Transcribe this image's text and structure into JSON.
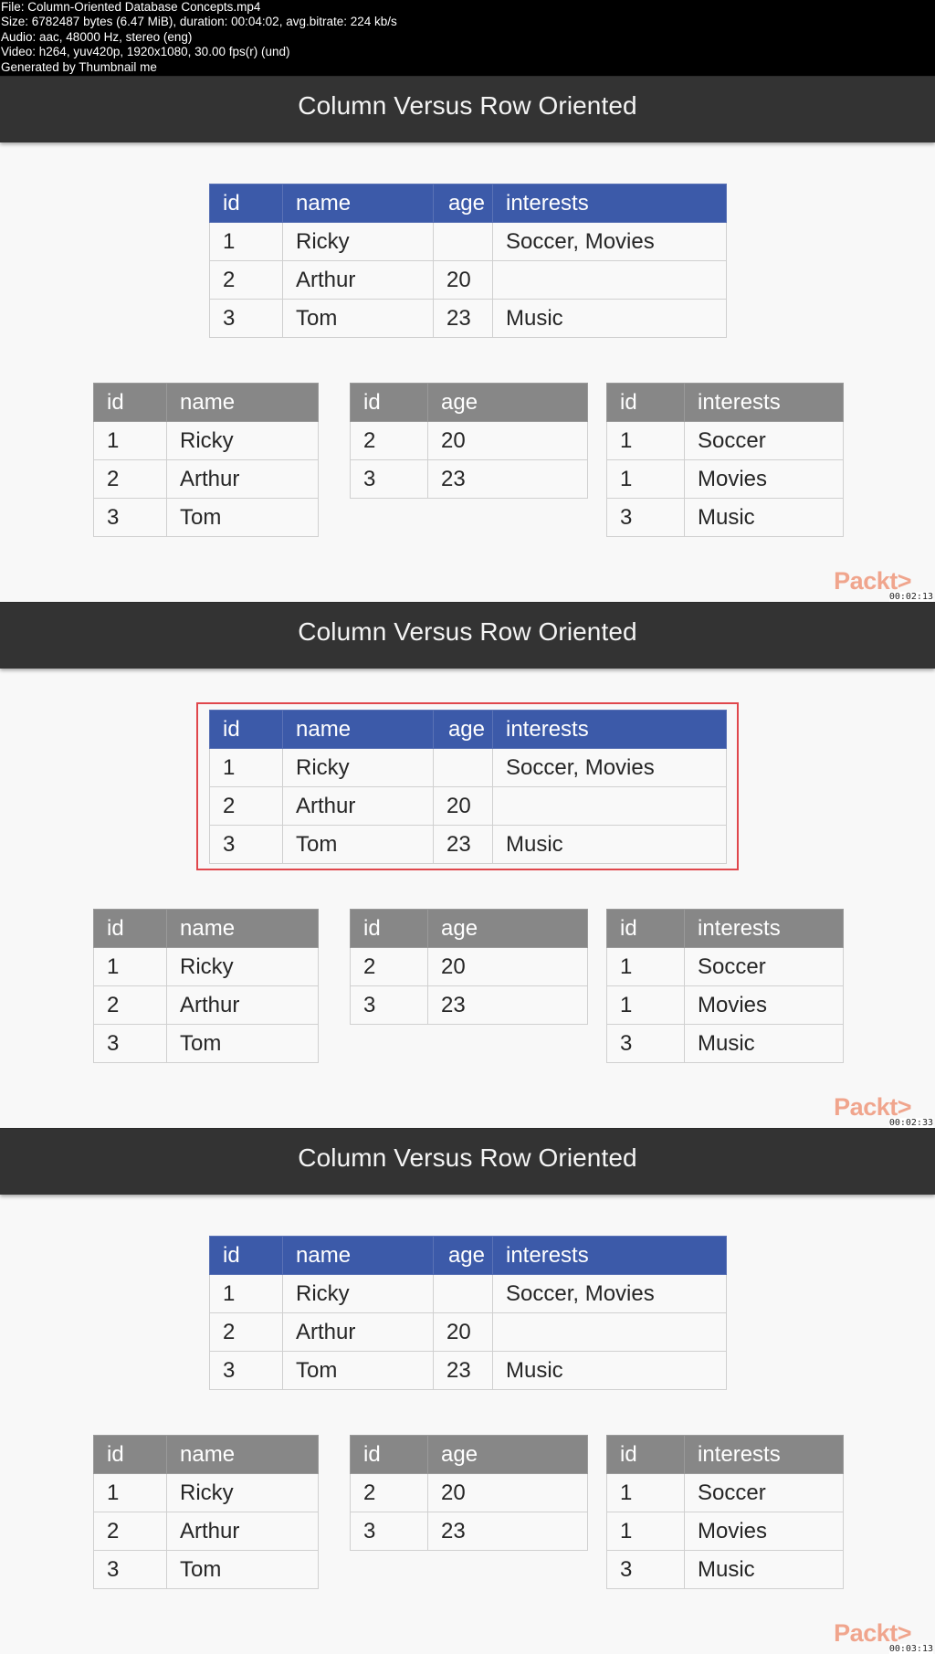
{
  "file_info": {
    "lines": [
      "File: Column-Oriented Database Concepts.mp4",
      "Size: 6782487 bytes (6.47 MiB), duration: 00:04:02, avg.bitrate: 224 kb/s",
      "Audio: aac, 48000 Hz, stereo (eng)",
      "Video: h264, yuv420p, 1920x1080, 30.00 fps(r) (und)",
      "Generated by Thumbnail me"
    ]
  },
  "colors": {
    "title_bar": "#333333",
    "row_table_header": "#3c5aa9",
    "column_table_header": "#878787",
    "highlight_border": "#e0474c",
    "logo": "#f0a58d"
  },
  "frames": [
    {
      "title": "Column Versus Row Oriented",
      "timestamp": "00:02:13",
      "logo": "Packt>",
      "row_table_highlighted": false
    },
    {
      "title": "Column Versus Row Oriented",
      "timestamp": "00:02:33",
      "logo": "Packt>",
      "row_table_highlighted": true
    },
    {
      "title": "Column Versus Row Oriented",
      "timestamp": "00:03:13",
      "logo": "Packt>",
      "row_table_highlighted": false
    }
  ],
  "row_table": {
    "headers": [
      "id",
      "name",
      "age",
      "interests"
    ],
    "rows": [
      [
        "1",
        "Ricky",
        "",
        "Soccer, Movies"
      ],
      [
        "2",
        "Arthur",
        "20",
        ""
      ],
      [
        "3",
        "Tom",
        "23",
        "Music"
      ]
    ]
  },
  "name_table": {
    "headers": [
      "id",
      "name"
    ],
    "rows": [
      [
        "1",
        "Ricky"
      ],
      [
        "2",
        "Arthur"
      ],
      [
        "3",
        "Tom"
      ]
    ]
  },
  "age_table": {
    "headers": [
      "id",
      "age"
    ],
    "rows": [
      [
        "2",
        "20"
      ],
      [
        "3",
        "23"
      ]
    ]
  },
  "interests_table": {
    "headers": [
      "id",
      "interests"
    ],
    "rows": [
      [
        "1",
        "Soccer"
      ],
      [
        "1",
        "Movies"
      ],
      [
        "3",
        "Music"
      ]
    ]
  }
}
